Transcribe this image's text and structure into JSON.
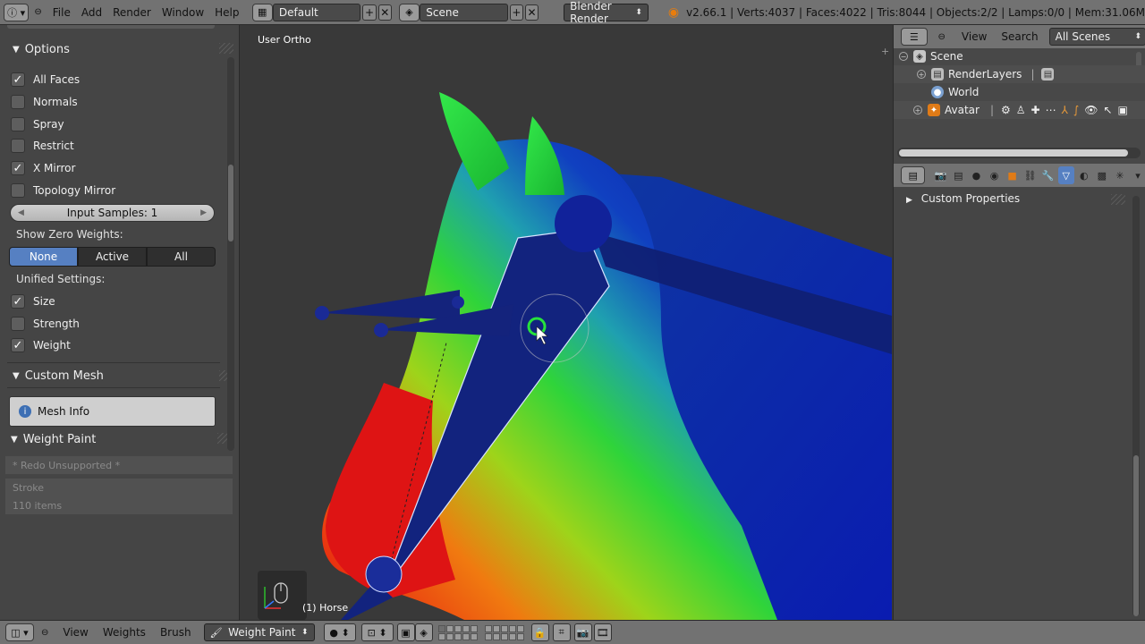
{
  "topbar": {
    "menus": [
      "File",
      "Add",
      "Render",
      "Window",
      "Help"
    ],
    "screen_layout": "Default",
    "scene": "Scene",
    "render_engine": "Blender Render",
    "stats": "v2.66.1 | Verts:4037 | Faces:4022 | Tris:8044 | Objects:2/2 | Lamps:0/0 | Mem:31.06M"
  },
  "left_panel": {
    "options_title": "Options",
    "checkboxes": [
      {
        "label": "All Faces",
        "checked": true
      },
      {
        "label": "Normals",
        "checked": false
      },
      {
        "label": "Spray",
        "checked": false
      },
      {
        "label": "Restrict",
        "checked": false
      },
      {
        "label": "X Mirror",
        "checked": true
      },
      {
        "label": "Topology Mirror",
        "checked": false
      }
    ],
    "input_samples": "Input Samples: 1",
    "show_zero_weights_label": "Show Zero Weights:",
    "zero_weight_options": [
      "None",
      "Active",
      "All"
    ],
    "zero_weight_selected": "None",
    "unified_settings_label": "Unified Settings:",
    "unified": [
      {
        "label": "Size",
        "checked": true
      },
      {
        "label": "Strength",
        "checked": false
      },
      {
        "label": "Weight",
        "checked": true
      }
    ],
    "custom_mesh_title": "Custom Mesh",
    "mesh_info": "Mesh Info",
    "weight_paint_title": "Weight Paint",
    "redo_unsupported": "* Redo Unsupported *",
    "stroke": "Stroke",
    "items_count": "110 items"
  },
  "viewport": {
    "view_label": "User Ortho",
    "object_label": "(1) Horse"
  },
  "outliner": {
    "view": "View",
    "search": "Search",
    "filter": "All Scenes",
    "rows": [
      {
        "label": "Scene"
      },
      {
        "label": "RenderLayers"
      },
      {
        "label": "World"
      },
      {
        "label": "Avatar"
      }
    ]
  },
  "properties": {
    "custom_properties": "Custom Properties"
  },
  "bottombar": {
    "menus": [
      "View",
      "Weights",
      "Brush"
    ],
    "mode": "Weight Paint"
  },
  "colors": {
    "accent": "#5680c2",
    "header": "#727272",
    "panel": "#454545"
  }
}
